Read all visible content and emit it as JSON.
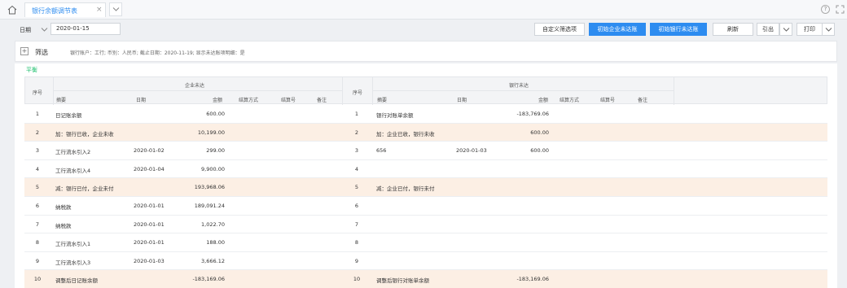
{
  "tabbar": {
    "tab_label": "银行余额调节表",
    "tab_close": "×",
    "help": "?"
  },
  "toolbar": {
    "type_label": "日期",
    "date_value": "2020-01-15",
    "custom_filter": "自定义筛选项",
    "init_company": "初始企业未达账",
    "init_bank": "初始银行未达账",
    "refresh": "刷新",
    "export": "引出",
    "print": "打印"
  },
  "filter": {
    "label": "筛选",
    "description": "银行账户：工行; 币别：人民币; 截止日期：2020-11-19; 显示未达账项明细：是"
  },
  "status": "平衡",
  "headers": {
    "seq": "序号",
    "company_group": "企业未达",
    "bank_group": "银行未达",
    "summary": "摘要",
    "date": "日期",
    "amount": "金额",
    "settle_method": "结算方式",
    "settle_no": "结算号",
    "remark": "备注"
  },
  "rows": [
    {
      "left_no": "1",
      "left_summary": "日记账余额",
      "left_date": "",
      "left_amount": "600.00",
      "right_no": "1",
      "right_summary": "银行对账单余额",
      "right_date": "",
      "right_amount": "-183,769.06",
      "highlight": false
    },
    {
      "left_no": "2",
      "left_summary": "加：银行已收，企业未收",
      "left_date": "",
      "left_amount": "10,199.00",
      "right_no": "2",
      "right_summary": "加：企业已收，银行未收",
      "right_date": "",
      "right_amount": "600.00",
      "highlight": true
    },
    {
      "left_no": "3",
      "left_summary": "工行流水引入2",
      "left_date": "2020-01-02",
      "left_amount": "299.00",
      "right_no": "3",
      "right_summary": "656",
      "right_date": "2020-01-03",
      "right_amount": "600.00",
      "highlight": false
    },
    {
      "left_no": "4",
      "left_summary": "工行流水引入4",
      "left_date": "2020-01-04",
      "left_amount": "9,900.00",
      "right_no": "4",
      "right_summary": "",
      "right_date": "",
      "right_amount": "",
      "highlight": false
    },
    {
      "left_no": "5",
      "left_summary": "减：银行已付，企业未付",
      "left_date": "",
      "left_amount": "193,968.06",
      "right_no": "5",
      "right_summary": "减：企业已付，银行未付",
      "right_date": "",
      "right_amount": "",
      "highlight": true
    },
    {
      "left_no": "6",
      "left_summary": "纳税款",
      "left_date": "2020-01-01",
      "left_amount": "189,091.24",
      "right_no": "6",
      "right_summary": "",
      "right_date": "",
      "right_amount": "",
      "highlight": false
    },
    {
      "left_no": "7",
      "left_summary": "纳税款",
      "left_date": "2020-01-01",
      "left_amount": "1,022.70",
      "right_no": "7",
      "right_summary": "",
      "right_date": "",
      "right_amount": "",
      "highlight": false
    },
    {
      "left_no": "8",
      "left_summary": "工行流水引入1",
      "left_date": "2020-01-01",
      "left_amount": "188.00",
      "right_no": "8",
      "right_summary": "",
      "right_date": "",
      "right_amount": "",
      "highlight": false
    },
    {
      "left_no": "9",
      "left_summary": "工行流水引入3",
      "left_date": "2020-01-03",
      "left_amount": "3,666.12",
      "right_no": "9",
      "right_summary": "",
      "right_date": "",
      "right_amount": "",
      "highlight": false
    },
    {
      "left_no": "10",
      "left_summary": "调整后日记账余额",
      "left_date": "",
      "left_amount": "-183,169.06",
      "right_no": "10",
      "right_summary": "调整后银行对账单余额",
      "right_date": "",
      "right_amount": "-183,169.06",
      "highlight": true
    }
  ]
}
